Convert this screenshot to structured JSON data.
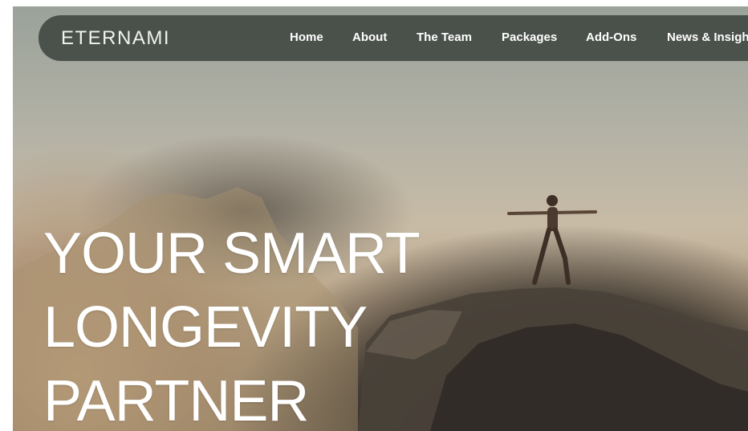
{
  "brand": {
    "logo_text": "ETERNAMI"
  },
  "nav": {
    "items": [
      {
        "label": "Home"
      },
      {
        "label": "About"
      },
      {
        "label": "The Team"
      },
      {
        "label": "Packages"
      },
      {
        "label": "Add-Ons"
      },
      {
        "label": "News & Insights"
      }
    ]
  },
  "hero": {
    "title_lines": [
      "YOUR SMART",
      "LONGEVITY",
      "PARTNER"
    ]
  },
  "colors": {
    "nav_background": "#323a34",
    "text": "#ffffff"
  }
}
